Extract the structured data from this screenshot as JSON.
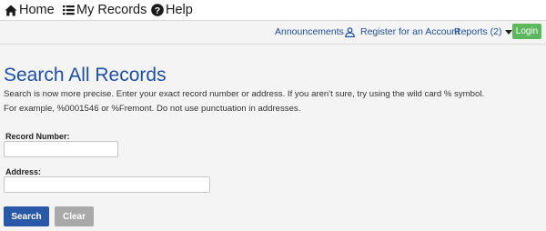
{
  "topnav": {
    "home": {
      "label": "Home",
      "icon": "home-icon"
    },
    "my_records": {
      "label": "My Records",
      "icon": "list-icon"
    },
    "help": {
      "label": "Help",
      "icon": "question-circle-icon"
    }
  },
  "secondary_nav": {
    "announcements": "Announcements",
    "register": {
      "label": "Register for an Account",
      "icon": "user-icon"
    },
    "reports": {
      "label": "Reports (2)",
      "icon": "caret-down-icon"
    },
    "login": "Login"
  },
  "main": {
    "title": "Search All Records",
    "help_line_1": "Search is now more precise. Enter your exact record number or address. If you aren't sure, try using the wild card % symbol.",
    "help_line_2": "For example, %0001546 or %Fremont. Do not use punctuation in addresses.",
    "record_number": {
      "label": "Record Number:",
      "value": "",
      "placeholder": ""
    },
    "address": {
      "label": "Address:",
      "value": "",
      "placeholder": ""
    },
    "search_button": "Search",
    "clear_button": "Clear"
  },
  "colors": {
    "link": "#1d4f9e",
    "title": "#1d4fa8",
    "login": "#5cb85c",
    "search_button": "#2a58a8",
    "clear_button": "#a9a9a9"
  }
}
